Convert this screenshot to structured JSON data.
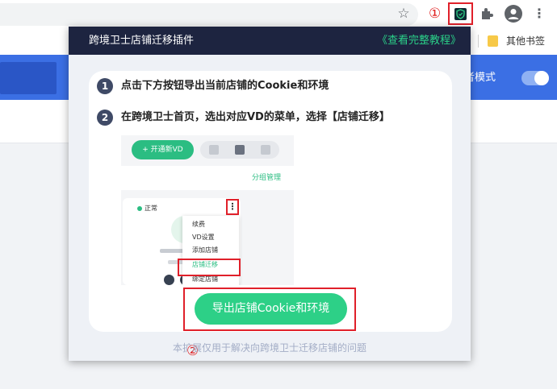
{
  "browser": {
    "circled_marker_1": "①",
    "bookmark_label": "其他书签",
    "dev_mode_label": "发者模式"
  },
  "popup": {
    "title": "跨境卫士店铺迁移插件",
    "tutorial_link": "《查看完整教程》",
    "steps": [
      {
        "num": "1",
        "text": "点击下方按钮导出当前店铺的Cookie和环境"
      },
      {
        "num": "2",
        "text": "在跨境卫士首页，选出对应VD的菜单，选择【店铺迁移】"
      }
    ],
    "illustration": {
      "new_vd_button": "+ 开通新VD",
      "group_manage": "分组管理",
      "status": "正常",
      "menu_items": [
        "续费",
        "VD设置",
        "添加店铺",
        "店铺迁移",
        "绑定店铺"
      ]
    },
    "circled_marker_2": "②",
    "export_button": "导出店铺Cookie和环境",
    "footer_note": "本扩展仅用于解决向跨境卫士迁移店铺的问题"
  },
  "colors": {
    "accent_green": "#2dd087",
    "popup_header": "#1d2440",
    "highlight_red": "#e0202a",
    "page_blue": "#3b6fe4"
  }
}
